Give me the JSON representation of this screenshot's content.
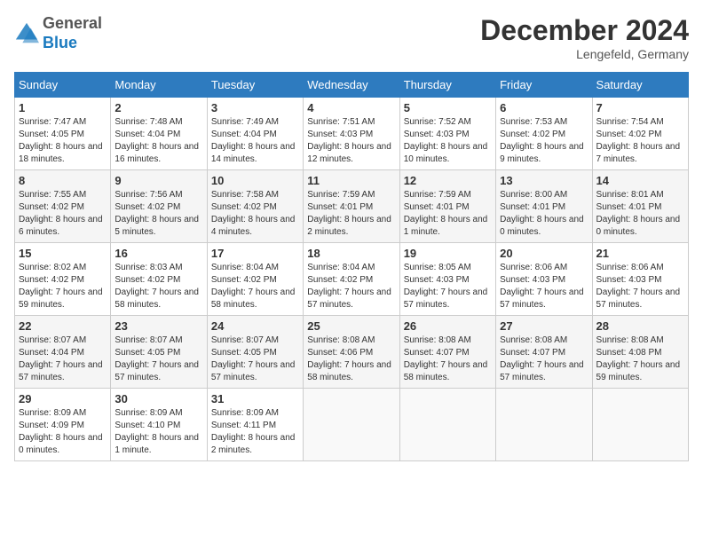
{
  "header": {
    "logo_line1": "General",
    "logo_line2": "Blue",
    "month_title": "December 2024",
    "location": "Lengefeld, Germany"
  },
  "weekdays": [
    "Sunday",
    "Monday",
    "Tuesday",
    "Wednesday",
    "Thursday",
    "Friday",
    "Saturday"
  ],
  "weeks": [
    [
      {
        "day": "1",
        "info": "Sunrise: 7:47 AM\nSunset: 4:05 PM\nDaylight: 8 hours and 18 minutes."
      },
      {
        "day": "2",
        "info": "Sunrise: 7:48 AM\nSunset: 4:04 PM\nDaylight: 8 hours and 16 minutes."
      },
      {
        "day": "3",
        "info": "Sunrise: 7:49 AM\nSunset: 4:04 PM\nDaylight: 8 hours and 14 minutes."
      },
      {
        "day": "4",
        "info": "Sunrise: 7:51 AM\nSunset: 4:03 PM\nDaylight: 8 hours and 12 minutes."
      },
      {
        "day": "5",
        "info": "Sunrise: 7:52 AM\nSunset: 4:03 PM\nDaylight: 8 hours and 10 minutes."
      },
      {
        "day": "6",
        "info": "Sunrise: 7:53 AM\nSunset: 4:02 PM\nDaylight: 8 hours and 9 minutes."
      },
      {
        "day": "7",
        "info": "Sunrise: 7:54 AM\nSunset: 4:02 PM\nDaylight: 8 hours and 7 minutes."
      }
    ],
    [
      {
        "day": "8",
        "info": "Sunrise: 7:55 AM\nSunset: 4:02 PM\nDaylight: 8 hours and 6 minutes."
      },
      {
        "day": "9",
        "info": "Sunrise: 7:56 AM\nSunset: 4:02 PM\nDaylight: 8 hours and 5 minutes."
      },
      {
        "day": "10",
        "info": "Sunrise: 7:58 AM\nSunset: 4:02 PM\nDaylight: 8 hours and 4 minutes."
      },
      {
        "day": "11",
        "info": "Sunrise: 7:59 AM\nSunset: 4:01 PM\nDaylight: 8 hours and 2 minutes."
      },
      {
        "day": "12",
        "info": "Sunrise: 7:59 AM\nSunset: 4:01 PM\nDaylight: 8 hours and 1 minute."
      },
      {
        "day": "13",
        "info": "Sunrise: 8:00 AM\nSunset: 4:01 PM\nDaylight: 8 hours and 0 minutes."
      },
      {
        "day": "14",
        "info": "Sunrise: 8:01 AM\nSunset: 4:01 PM\nDaylight: 8 hours and 0 minutes."
      }
    ],
    [
      {
        "day": "15",
        "info": "Sunrise: 8:02 AM\nSunset: 4:02 PM\nDaylight: 7 hours and 59 minutes."
      },
      {
        "day": "16",
        "info": "Sunrise: 8:03 AM\nSunset: 4:02 PM\nDaylight: 7 hours and 58 minutes."
      },
      {
        "day": "17",
        "info": "Sunrise: 8:04 AM\nSunset: 4:02 PM\nDaylight: 7 hours and 58 minutes."
      },
      {
        "day": "18",
        "info": "Sunrise: 8:04 AM\nSunset: 4:02 PM\nDaylight: 7 hours and 57 minutes."
      },
      {
        "day": "19",
        "info": "Sunrise: 8:05 AM\nSunset: 4:03 PM\nDaylight: 7 hours and 57 minutes."
      },
      {
        "day": "20",
        "info": "Sunrise: 8:06 AM\nSunset: 4:03 PM\nDaylight: 7 hours and 57 minutes."
      },
      {
        "day": "21",
        "info": "Sunrise: 8:06 AM\nSunset: 4:03 PM\nDaylight: 7 hours and 57 minutes."
      }
    ],
    [
      {
        "day": "22",
        "info": "Sunrise: 8:07 AM\nSunset: 4:04 PM\nDaylight: 7 hours and 57 minutes."
      },
      {
        "day": "23",
        "info": "Sunrise: 8:07 AM\nSunset: 4:05 PM\nDaylight: 7 hours and 57 minutes."
      },
      {
        "day": "24",
        "info": "Sunrise: 8:07 AM\nSunset: 4:05 PM\nDaylight: 7 hours and 57 minutes."
      },
      {
        "day": "25",
        "info": "Sunrise: 8:08 AM\nSunset: 4:06 PM\nDaylight: 7 hours and 58 minutes."
      },
      {
        "day": "26",
        "info": "Sunrise: 8:08 AM\nSunset: 4:07 PM\nDaylight: 7 hours and 58 minutes."
      },
      {
        "day": "27",
        "info": "Sunrise: 8:08 AM\nSunset: 4:07 PM\nDaylight: 7 hours and 57 minutes."
      },
      {
        "day": "28",
        "info": "Sunrise: 8:08 AM\nSunset: 4:08 PM\nDaylight: 7 hours and 59 minutes."
      }
    ],
    [
      {
        "day": "29",
        "info": "Sunrise: 8:09 AM\nSunset: 4:09 PM\nDaylight: 8 hours and 0 minutes."
      },
      {
        "day": "30",
        "info": "Sunrise: 8:09 AM\nSunset: 4:10 PM\nDaylight: 8 hours and 1 minute."
      },
      {
        "day": "31",
        "info": "Sunrise: 8:09 AM\nSunset: 4:11 PM\nDaylight: 8 hours and 2 minutes."
      },
      null,
      null,
      null,
      null
    ]
  ]
}
